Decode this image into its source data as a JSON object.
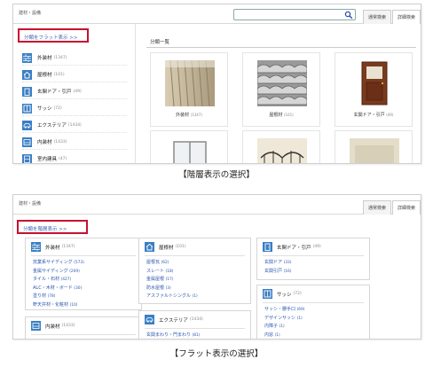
{
  "hierarchy_view": {
    "breadcrumb": "建材・設備",
    "tabs": [
      "通常検索",
      "詳細検索"
    ],
    "toggle_label": "分類をフラット表示 >>",
    "sidebar": [
      {
        "label": "外装材",
        "count": "(1347)",
        "icon": "wall-icon"
      },
      {
        "label": "屋根材",
        "count": "(101)",
        "icon": "house-icon"
      },
      {
        "label": "玄関ドア・引戸",
        "count": "(49)",
        "icon": "door-icon"
      },
      {
        "label": "サッシ",
        "count": "(72)",
        "icon": "window-icon"
      },
      {
        "label": "エクステリア",
        "count": "(1434)",
        "icon": "car-icon"
      },
      {
        "label": "内装材",
        "count": "(1433)",
        "icon": "interior-icon"
      },
      {
        "label": "室内建具",
        "count": "(47)",
        "icon": "fitting-icon"
      }
    ],
    "main_title": "分類一覧",
    "cards": [
      {
        "label": "外装材",
        "count": "(1347)"
      },
      {
        "label": "屋根材",
        "count": "(101)"
      },
      {
        "label": "玄関ドア・引戸",
        "count": "(49)"
      }
    ],
    "caption": "【階層表示の選択】"
  },
  "flat_view": {
    "breadcrumb": "建材・設備",
    "tabs": [
      "通常検索",
      "詳細検索"
    ],
    "toggle_label": "分類を階層表示 >>",
    "boxes": {
      "exterior_wall": {
        "title": "外装材",
        "count": "(1347)",
        "items": [
          {
            "label": "窯業系サイディング",
            "count": "(573)"
          },
          {
            "label": "金属サイディング",
            "count": "(209)"
          },
          {
            "label": "タイル・石材",
            "count": "(427)"
          },
          {
            "label": "ALC・木材・ボード",
            "count": "(30)"
          },
          {
            "label": "塗り材",
            "count": "(78)"
          },
          {
            "label": "軒天井材・化粧材",
            "count": "(10)"
          }
        ]
      },
      "roof": {
        "title": "屋根材",
        "count": "(101)",
        "items": [
          {
            "label": "屋根瓦",
            "count": "(62)"
          },
          {
            "label": "スレート",
            "count": "(18)"
          },
          {
            "label": "金属屋根",
            "count": "(17)"
          },
          {
            "label": "防水屋根",
            "count": "(3)"
          },
          {
            "label": "アスファルトシングル",
            "count": "(1)"
          }
        ]
      },
      "door": {
        "title": "玄関ドア・引戸",
        "count": "(49)",
        "items": [
          {
            "label": "玄関ドア",
            "count": "(33)"
          },
          {
            "label": "玄関引戸",
            "count": "(16)"
          }
        ]
      },
      "sash": {
        "title": "サッシ",
        "count": "(72)",
        "items": [
          {
            "label": "サッシ・勝手口",
            "count": "(69)"
          },
          {
            "label": "デザインサッシ",
            "count": "(1)"
          },
          {
            "label": "内障子",
            "count": "(1)"
          },
          {
            "label": "内窓",
            "count": "(1)"
          }
        ]
      },
      "interior": {
        "title": "内装材",
        "count": "(1433)",
        "items": []
      },
      "exterior": {
        "title": "エクステリア",
        "count": "(1434)",
        "items": [
          {
            "label": "玄関まわり・門まわり",
            "count": "(81)"
          }
        ]
      }
    },
    "caption": "【フラット表示の選択】"
  },
  "colors": {
    "accent_blue": "#3b7fc4",
    "link_blue": "#2a56b0",
    "highlight_red": "#c8102e"
  }
}
